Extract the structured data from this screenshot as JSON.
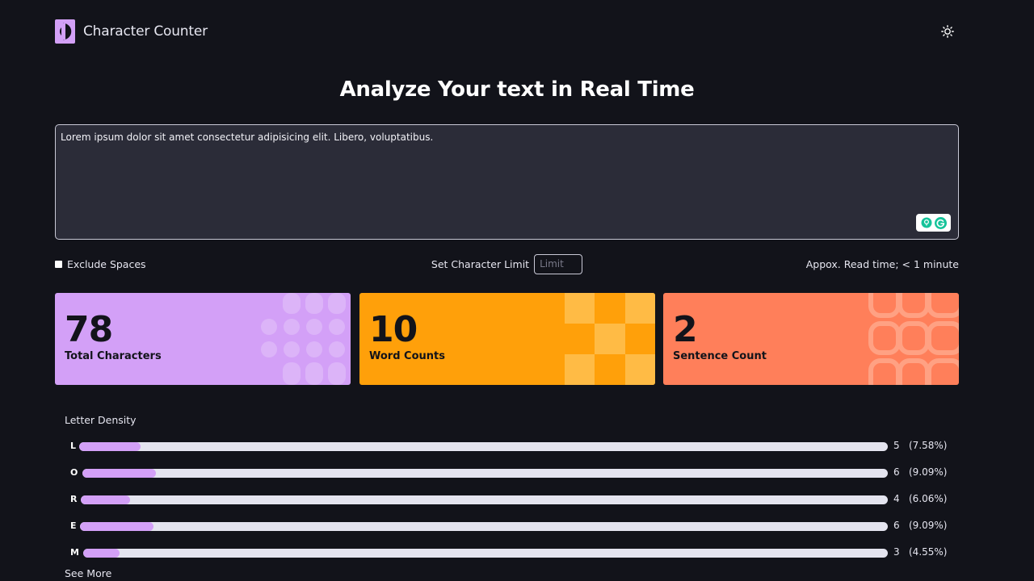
{
  "header": {
    "app_name": "Character Counter",
    "logo_icon": "logo-icon",
    "theme_icon": "sun-icon"
  },
  "main": {
    "title": "Analyze Your text in Real Time",
    "textarea_value": "Lorem ipsum dolor sit amet consectetur adipisicing elit. Libero, voluptatibus."
  },
  "options": {
    "exclude_spaces_label": "Exclude Spaces",
    "character_limit_label": "Set Character Limit",
    "limit_placeholder": "Limit",
    "read_time": "Appox. Read time; < 1 minute"
  },
  "stats": [
    {
      "value": "78",
      "label": "Total Characters",
      "color": "#d3a0f7"
    },
    {
      "value": "10",
      "label": "Word Counts",
      "color": "#ffa00a"
    },
    {
      "value": "2",
      "label": "Sentence Count",
      "color": "#ff7f5a"
    }
  ],
  "density": {
    "title": "Letter Density",
    "items": [
      {
        "letter": "L",
        "count": "5",
        "percent": "(7.58%)",
        "fraction": 0.0758
      },
      {
        "letter": "O",
        "count": "6",
        "percent": "(9.09%)",
        "fraction": 0.0909
      },
      {
        "letter": "R",
        "count": "4",
        "percent": "(6.06%)",
        "fraction": 0.0606
      },
      {
        "letter": "E",
        "count": "6",
        "percent": "(9.09%)",
        "fraction": 0.0909
      },
      {
        "letter": "M",
        "count": "3",
        "percent": "(4.55%)",
        "fraction": 0.0455
      }
    ],
    "see_more": "See More"
  },
  "colors": {
    "background": "#12131a",
    "accent": "#d3a0f7"
  }
}
